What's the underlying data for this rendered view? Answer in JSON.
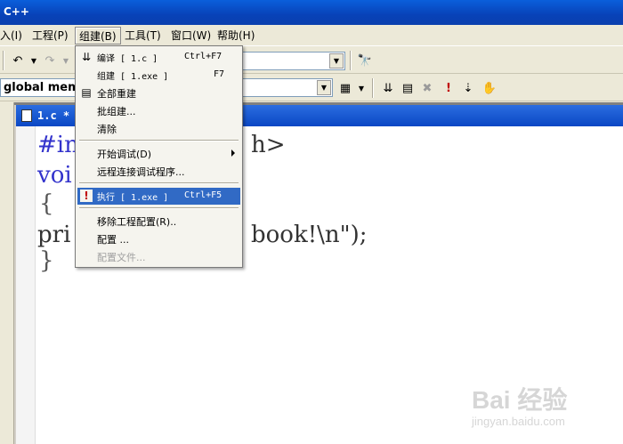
{
  "window": {
    "title": "C++"
  },
  "menubar": {
    "items": [
      {
        "label": "入(I)"
      },
      {
        "label": "工程(P)"
      },
      {
        "label": "组建(B)"
      },
      {
        "label": "工具(T)"
      },
      {
        "label": "窗口(W)"
      },
      {
        "label": "帮助(H)"
      }
    ]
  },
  "toolbar2": {
    "scope_combo": "global memb"
  },
  "document": {
    "tab_title": "1.c *",
    "code_lines": [
      "#in",
      "voi",
      "{",
      "pri",
      "}"
    ],
    "code_fragments": [
      "h>",
      "book!\\n\");"
    ]
  },
  "build_menu": {
    "items": [
      {
        "label": "编译 [ 1.c ]",
        "shortcut": "Ctrl+F7",
        "icon": "compile-icon"
      },
      {
        "label": "组建 [ 1.exe ]",
        "shortcut": "F7",
        "icon": ""
      },
      {
        "label": "全部重建",
        "shortcut": "",
        "icon": "rebuild-all-icon"
      },
      {
        "label": "批组建...",
        "shortcut": "",
        "icon": ""
      },
      {
        "label": "清除",
        "shortcut": "",
        "icon": ""
      },
      {
        "label": "开始调试(D)",
        "shortcut": "",
        "icon": ""
      },
      {
        "label": "远程连接调试程序...",
        "shortcut": "",
        "icon": ""
      },
      {
        "label": "执行 [ 1.exe ]",
        "shortcut": "Ctrl+F5",
        "icon": "execute-icon"
      },
      {
        "label": "移除工程配置(R)..",
        "shortcut": "",
        "icon": ""
      },
      {
        "label": "配置 ...",
        "shortcut": "",
        "icon": ""
      },
      {
        "label": "配置文件...",
        "shortcut": "",
        "icon": ""
      }
    ]
  },
  "watermark": {
    "brand": "Bai 经验",
    "url": "jingyan.baidu.com"
  }
}
